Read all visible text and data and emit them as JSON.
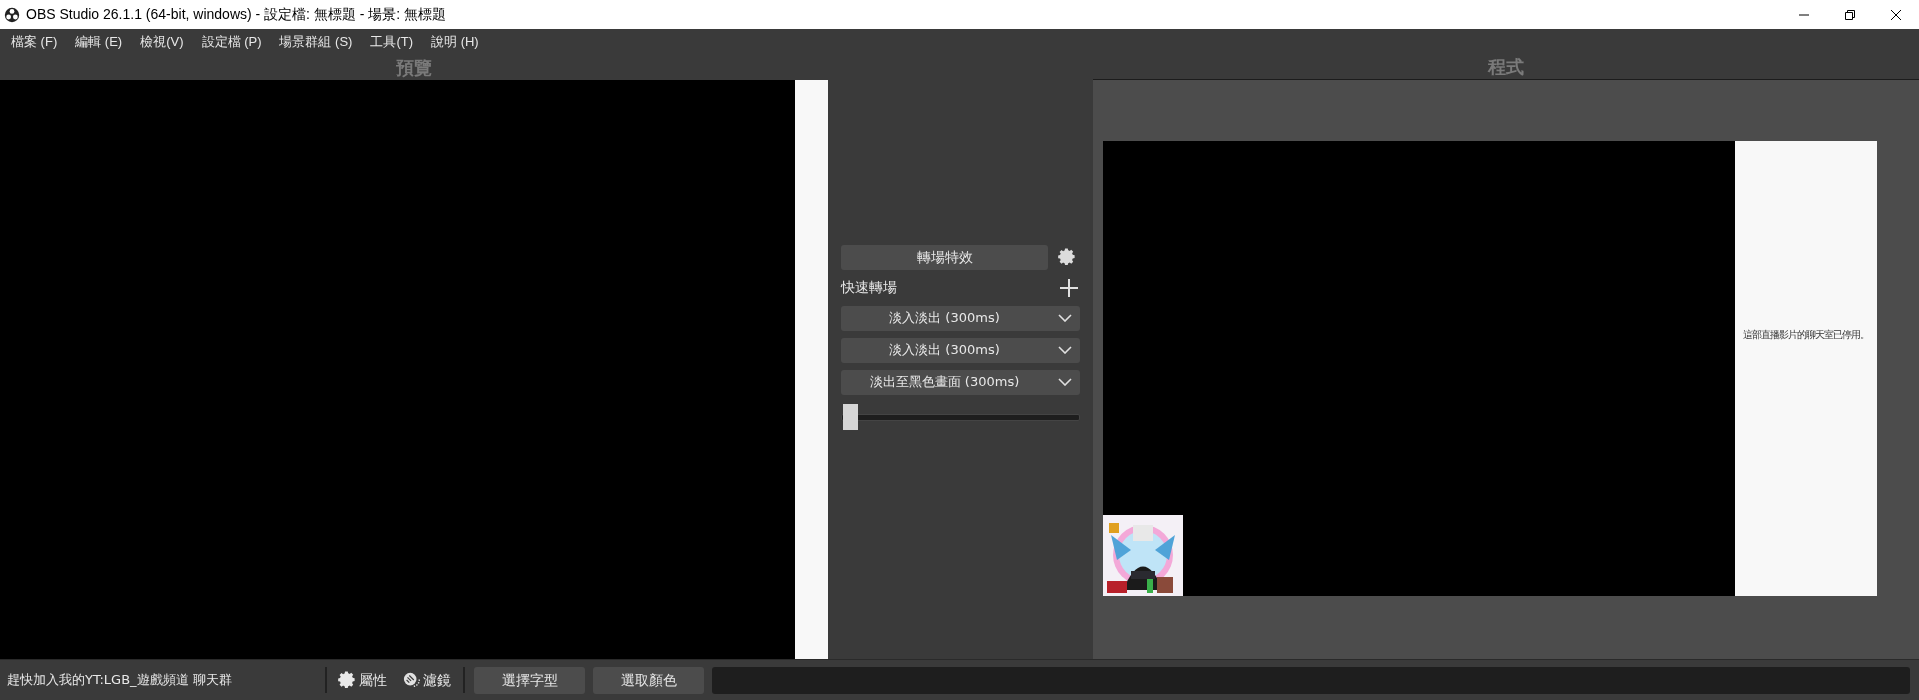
{
  "window": {
    "title": "OBS Studio 26.1.1 (64-bit, windows) - 設定檔: 無標題 - 場景: 無標題"
  },
  "menu": [
    "檔案 (F)",
    "編輯 (E)",
    "檢視(V)",
    "設定檔 (P)",
    "場景群組 (S)",
    "工具(T)",
    "說明 (H)"
  ],
  "preview": {
    "label": "預覽"
  },
  "transitions": {
    "button": "轉場特效",
    "quick_label": "快速轉場",
    "dropdowns": [
      "淡入淡出 (300ms)",
      "淡入淡出 (300ms)",
      "淡出至黑色畫面 (300ms)"
    ],
    "slider": {
      "level": 0
    }
  },
  "program": {
    "label": "程式",
    "chat_notice": "這部直播影片的聊天室已停用。"
  },
  "bottom_bar": {
    "source_name": "趕快加入我的YT:LGB_遊戲頻道 聊天群",
    "properties": "屬性",
    "filters": "濾鏡",
    "buttons": [
      "選擇字型",
      "選取顏色"
    ]
  }
}
